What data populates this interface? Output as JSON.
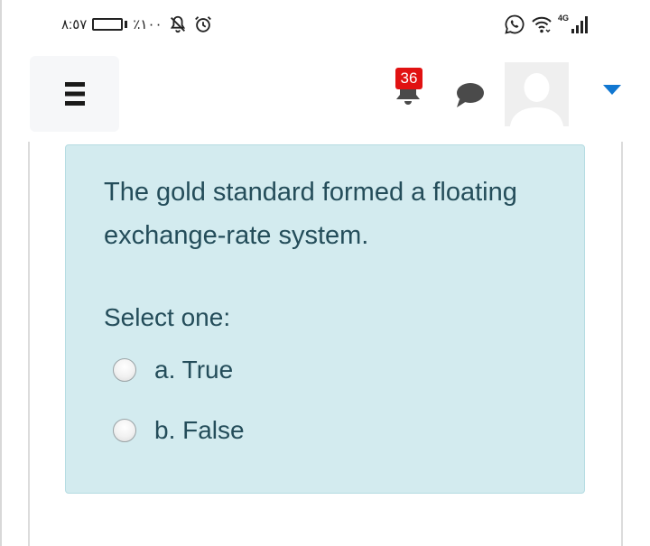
{
  "status_bar": {
    "time": "٨:٥٧",
    "battery_percent": "٪١٠٠",
    "battery_level": 1.0,
    "network_label": "4G",
    "icons": [
      "battery-icon",
      "mute-icon",
      "alarm-icon",
      "whatsapp-icon",
      "wifi-icon",
      "signal-icon"
    ]
  },
  "nav": {
    "menu_icon": "hamburger-icon",
    "notification_count": "36",
    "icons": [
      "bell-icon",
      "chat-icon",
      "avatar",
      "caret-down-icon"
    ],
    "accent_color": "#1177d1",
    "badge_color": "#e11212"
  },
  "question": {
    "text": "The gold standard formed a floating exchange-rate system.",
    "prompt": "Select one:",
    "options": [
      {
        "label": "a. True",
        "selected": false
      },
      {
        "label": "b. False",
        "selected": false
      }
    ],
    "card_color": "#d3ebef",
    "text_color": "#244d5a"
  }
}
